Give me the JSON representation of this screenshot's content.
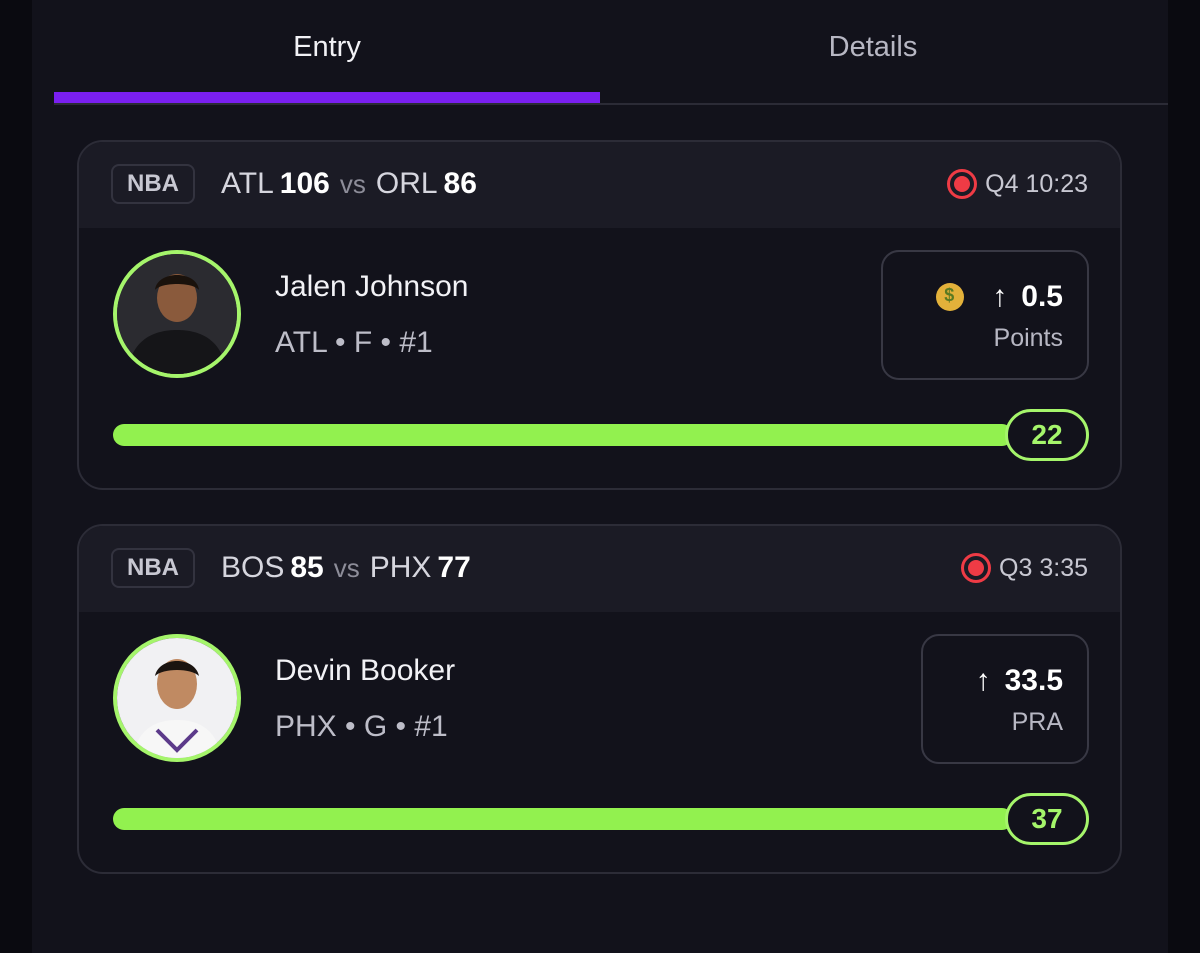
{
  "tabs": [
    {
      "label": "Entry",
      "active": true
    },
    {
      "label": "Details",
      "active": false
    }
  ],
  "colors": {
    "accent": "#7a1ff0",
    "progress": "#92f14f",
    "live": "#ef3b45"
  },
  "picks": [
    {
      "league": "NBA",
      "home_team": "ATL",
      "home_score": "106",
      "vs": "vs",
      "away_team": "ORL",
      "away_score": "86",
      "period": "Q4 10:23",
      "player_name": "Jalen Johnson",
      "player_meta": "ATL • F • #1",
      "has_promo": true,
      "promo_icon": "money-mouth-face-icon",
      "direction_icon": "arrow-up-icon",
      "line": "0.5",
      "stat": "Points",
      "current": "22",
      "progress": 1.0
    },
    {
      "league": "NBA",
      "home_team": "BOS",
      "home_score": "85",
      "vs": "vs",
      "away_team": "PHX",
      "away_score": "77",
      "period": "Q3 3:35",
      "player_name": "Devin Booker",
      "player_meta": "PHX • G • #1",
      "has_promo": false,
      "direction_icon": "arrow-up-icon",
      "line": "33.5",
      "stat": "PRA",
      "current": "37",
      "progress": 1.0
    }
  ]
}
